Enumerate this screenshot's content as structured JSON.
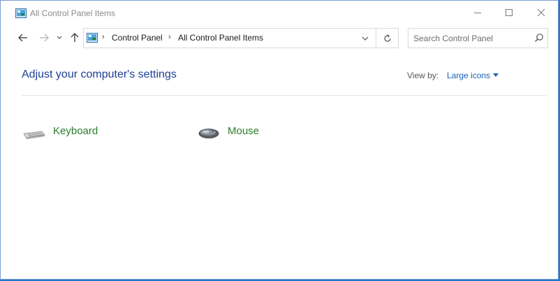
{
  "window": {
    "title": "All Control Panel Items",
    "controls": {
      "minimize": "minimize-icon",
      "maximize": "maximize-icon",
      "close": "close-icon"
    }
  },
  "navigation": {
    "back": "back-arrow-icon",
    "forward": "forward-arrow-icon",
    "recent": "chevron-down-icon",
    "up": "up-arrow-icon"
  },
  "address_bar": {
    "breadcrumbs": [
      "Control Panel",
      "All Control Panel Items"
    ],
    "separator": "›"
  },
  "search": {
    "placeholder": "Search Control Panel",
    "value": ""
  },
  "main": {
    "heading": "Adjust your computer's settings",
    "view_by_label": "View by:",
    "view_by_value": "Large icons",
    "items": [
      {
        "label": "Keyboard",
        "icon": "keyboard-icon"
      },
      {
        "label": "Mouse",
        "icon": "mouse-icon"
      }
    ]
  },
  "colors": {
    "heading": "#1c3f94",
    "link": "#1a5fb4",
    "item_label": "#2a7d2a",
    "desktop": "#1f78c9"
  }
}
